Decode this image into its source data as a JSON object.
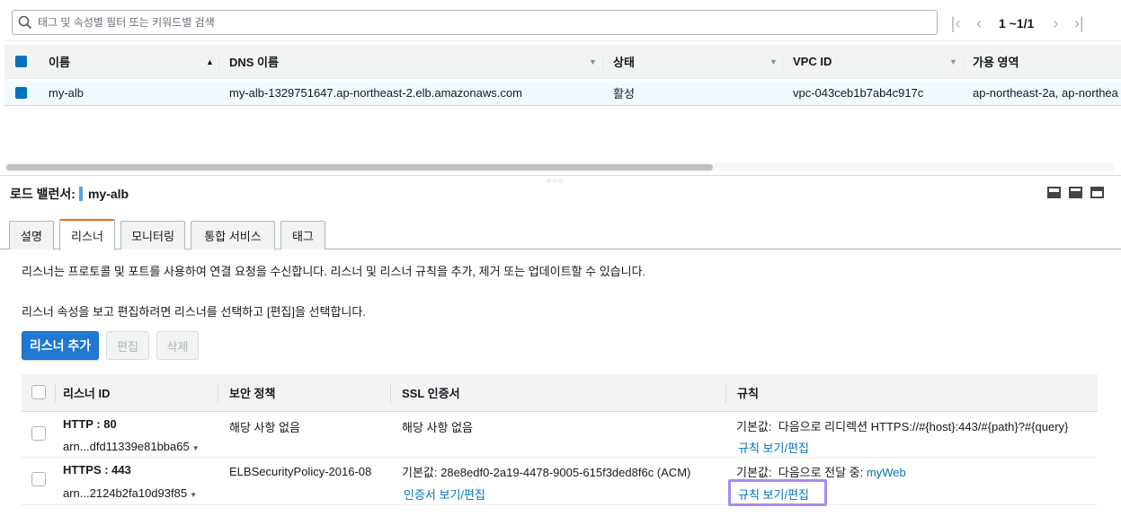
{
  "search": {
    "placeholder": "태그 및 속성별 필터 또는 키워드별 검색",
    "pagination": "1 ~1/1"
  },
  "grid": {
    "columns": [
      "이름",
      "DNS 이름",
      "상태",
      "VPC ID",
      "가용 영역"
    ],
    "rows": [
      {
        "name": "my-alb",
        "dns": "my-alb-1329751647.ap-northeast-2.elb.amazonaws.com",
        "state": "활성",
        "vpc": "vpc-043ceb1b7ab4c917c",
        "az": "ap-northeast-2a, ap-northea"
      }
    ]
  },
  "detail": {
    "title_label": "로드 밸런서:",
    "title_value": "my-alb",
    "tabs": [
      "설명",
      "리스너",
      "모니터링",
      "통합 서비스",
      "태그"
    ],
    "active_tab": "리스너",
    "desc1": "리스너는 프로토콜 및 포트를 사용하여 연결 요청을 수신합니다. 리스너 및 리스너 규칙을 추가, 제거 또는 업데이트할 수 있습니다.",
    "desc2": "리스너 속성을 보고 편집하려면 리스너를 선택하고 [편집]을 선택합니다.",
    "buttons": {
      "add": "리스너 추가",
      "edit": "편집",
      "delete": "삭제"
    }
  },
  "listeners": {
    "columns": [
      "리스너 ID",
      "보안 정책",
      "SSL 인증서",
      "규칙"
    ],
    "rows": [
      {
        "id": "HTTP : 80",
        "arn": "arn...dfd11339e81bba65",
        "policy": "해당 사항 없음",
        "ssl": "해당 사항 없음",
        "ssl_link": "",
        "rule_default_label": "기본값:",
        "rule_text": "다음으로 리디렉션 HTTPS://#{host}:443/#{path}?#{query}",
        "rule_target": "",
        "rule_link": "규칙 보기/편집"
      },
      {
        "id": "HTTPS : 443",
        "arn": "arn...2124b2fa10d93f85",
        "policy": "ELBSecurityPolicy-2016-08",
        "ssl": "기본값:  28e8edf0-2a19-4478-9005-615f3ded8f6c (ACM)",
        "ssl_link": "인증서 보기/편집",
        "rule_default_label": "기본값:",
        "rule_text": "다음으로 전달 중:",
        "rule_target": "myWeb",
        "rule_link": "규칙 보기/편집"
      }
    ]
  },
  "colors": {
    "accent": "#0073bb",
    "primary_button": "#1f78d1",
    "active_tab": "#ec7211",
    "highlight": "#a98af0"
  }
}
